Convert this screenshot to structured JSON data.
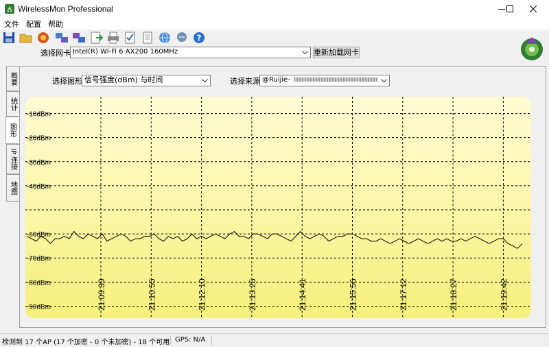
{
  "window": {
    "title": "WirelessMon Professional"
  },
  "menu": [
    "文件",
    "配置",
    "帮助"
  ],
  "toolbar_icons": [
    "save-icon",
    "open-folder-icon",
    "record-icon",
    "network-computers-icon",
    "network-settings-icon",
    "export-icon",
    "print-icon",
    "checklist-icon",
    "notes-icon",
    "globe-icon",
    "chat-icon",
    "help-icon"
  ],
  "adapter": {
    "label": "选择网卡",
    "value": "Intel(R) Wi-Fi 6 AX200 160MHz",
    "reload_label": "重新加载网卡"
  },
  "side_tabs": [
    "概要",
    "统计",
    "图形",
    "IP 连接",
    "地图"
  ],
  "active_tab": "图形",
  "graph_controls": {
    "graph_label": "选择图形",
    "graph_value": "信号强度(dBm) 与时间",
    "source_label": "选择来源",
    "source_value": "@Ruijie-"
  },
  "chart_data": {
    "type": "line",
    "ylim": [
      -95,
      -3
    ],
    "y_ticks": [
      -10,
      -20,
      -30,
      -40,
      -50,
      -60,
      -70,
      -80,
      -90
    ],
    "y_tick_labels": [
      "-10dBm",
      "-20dBm",
      "-30dBm",
      "-40dBm",
      "",
      "-60dBm",
      "-70dBm",
      "-80dBm",
      "-90dBm"
    ],
    "x_ticks": [
      "21:09:39",
      "21:10:55",
      "21:12:10",
      "21:13:25",
      "21:14:41",
      "21:15:56",
      "21:17:12",
      "21:18:27",
      "21:19:42"
    ],
    "grid": true,
    "series": [
      {
        "values": [
          -61,
          -62,
          -63,
          -61,
          -62,
          -64,
          -62,
          -62,
          -61,
          -62,
          -59,
          -61,
          -62,
          -60,
          -61,
          -62,
          -60,
          -63,
          -62,
          -61,
          -60,
          -61,
          -63,
          -62,
          -62,
          -61,
          -61,
          -60,
          -62,
          -63,
          -61,
          -62,
          -61,
          -63,
          -62,
          -60,
          -62,
          -61,
          -62,
          -61,
          -60,
          -61,
          -62,
          -60,
          -59,
          -61,
          -61,
          -62,
          -60,
          -60,
          -61,
          -62,
          -60,
          -60,
          -61,
          -62,
          -63,
          -61,
          -59,
          -61,
          -62,
          -61,
          -60,
          -61,
          -63,
          -62,
          -61,
          -61,
          -60,
          -60,
          -61,
          -62,
          -62,
          -63,
          -63,
          -62,
          -63,
          -64,
          -63,
          -62,
          -63,
          -64,
          -63,
          -62,
          -63,
          -64,
          -63,
          -62,
          -63,
          -62,
          -63,
          -63,
          -62,
          -63,
          -62,
          -61,
          -62,
          -63,
          -64,
          -63,
          -62,
          -62,
          -64,
          -65,
          -66,
          -64
        ]
      }
    ]
  },
  "status": {
    "ap_summary": "检测到 17 个AP (17 个加密 - 0 个未加密) - 18 个可用",
    "gps": "GPS: N/A"
  }
}
